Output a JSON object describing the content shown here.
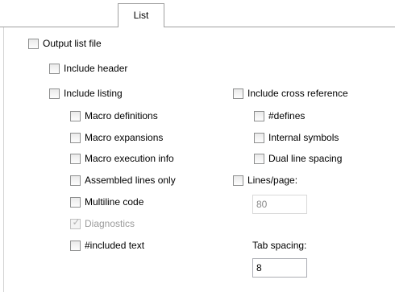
{
  "tabs": [
    {
      "label": "List",
      "active": true
    }
  ],
  "options": {
    "output_list_file": {
      "label": "Output list file",
      "checked": false,
      "enabled": true
    },
    "include_header": {
      "label": "Include header",
      "checked": false,
      "enabled": true
    },
    "include_listing": {
      "label": "Include listing",
      "checked": false,
      "enabled": true
    },
    "macro_definitions": {
      "label": "Macro definitions",
      "checked": false,
      "enabled": true
    },
    "macro_expansions": {
      "label": "Macro expansions",
      "checked": false,
      "enabled": true
    },
    "macro_execution_info": {
      "label": "Macro execution info",
      "checked": false,
      "enabled": true
    },
    "assembled_lines_only": {
      "label": "Assembled lines only",
      "checked": false,
      "enabled": true
    },
    "multiline_code": {
      "label": "Multiline code",
      "checked": false,
      "enabled": true
    },
    "diagnostics": {
      "label": "Diagnostics",
      "checked": true,
      "enabled": false
    },
    "included_text": {
      "label": "#included text",
      "checked": false,
      "enabled": true
    },
    "include_cross_reference": {
      "label": "Include cross reference",
      "checked": false,
      "enabled": true
    },
    "defines": {
      "label": "#defines",
      "checked": false,
      "enabled": true
    },
    "internal_symbols": {
      "label": "Internal symbols",
      "checked": false,
      "enabled": true
    },
    "dual_line_spacing": {
      "label": "Dual line spacing",
      "checked": false,
      "enabled": true
    },
    "lines_per_page": {
      "label": "Lines/page:",
      "checked": false,
      "enabled": true
    }
  },
  "fields": {
    "lines_per_page_value": {
      "value": "80",
      "enabled": false
    },
    "tab_spacing_label": "Tab spacing:",
    "tab_spacing_value": {
      "value": "8",
      "enabled": true
    }
  },
  "colors": {
    "tab_border": "#a0a0a0",
    "checkbox_border": "#8e8f8f",
    "disabled_text": "#9a9a9a"
  }
}
